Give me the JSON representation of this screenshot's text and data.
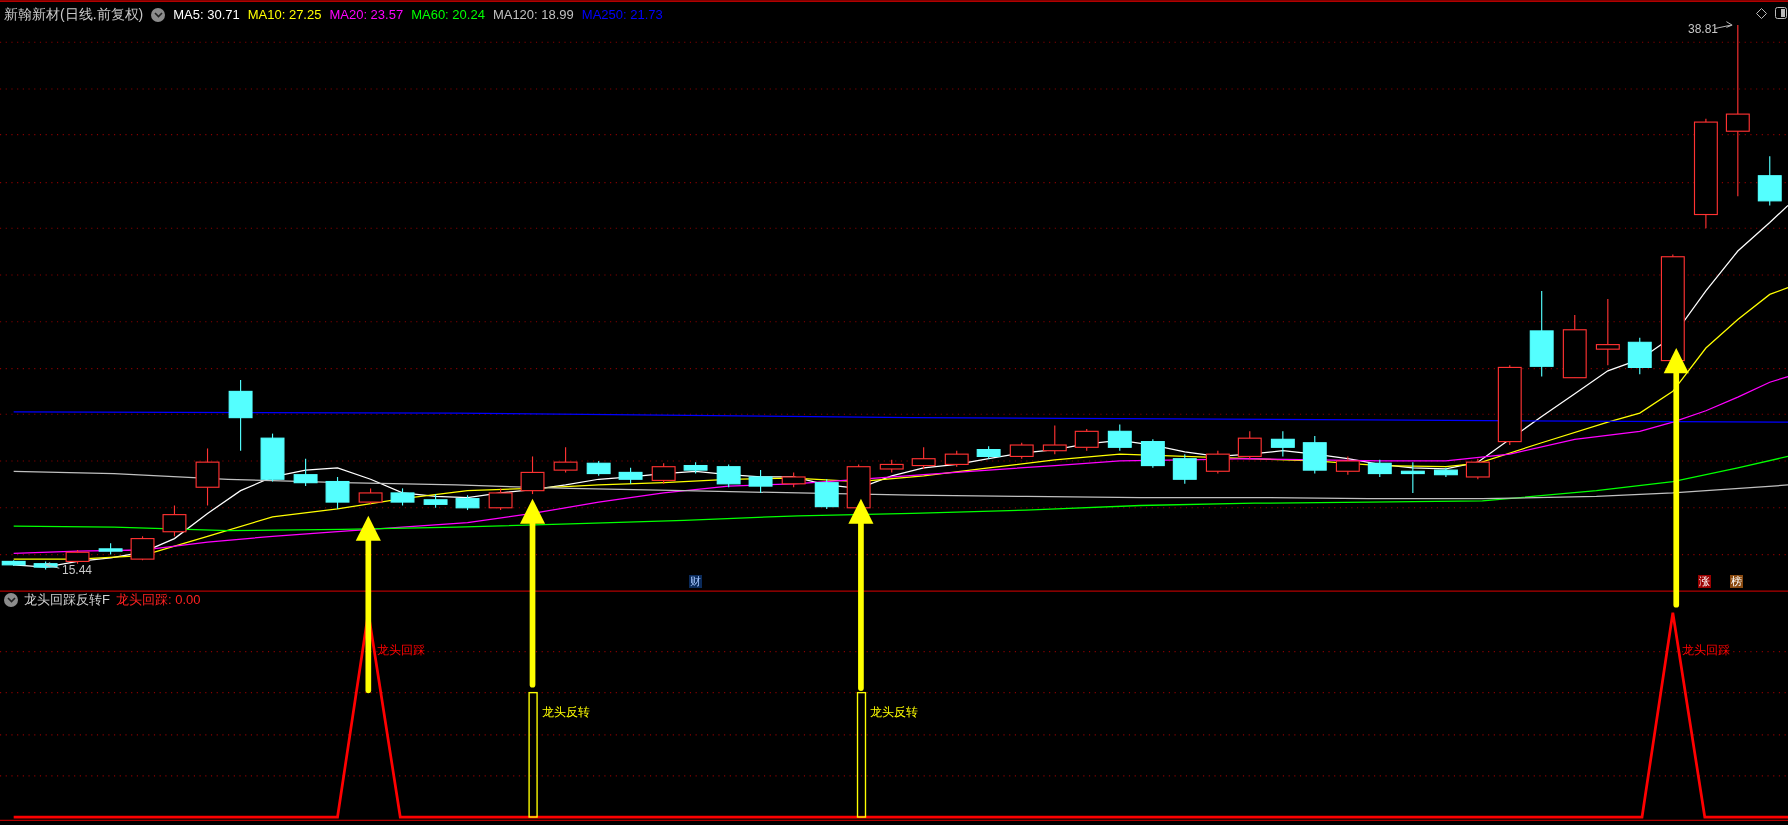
{
  "header": {
    "title": "新翰新材(日线.前复权)",
    "indicators": [
      {
        "label": "MA5: 30.71",
        "color": "#ffffff"
      },
      {
        "label": "MA10: 27.25",
        "color": "#ffff00"
      },
      {
        "label": "MA20: 23.57",
        "color": "#ff00ff"
      },
      {
        "label": "MA60: 20.24",
        "color": "#00ff00"
      },
      {
        "label": "MA120: 18.99",
        "color": "#c0c0c0"
      },
      {
        "label": "MA250: 21.73",
        "color": "#0000ff"
      }
    ]
  },
  "price_chart": {
    "high_label": "38.81",
    "low_label": "15.44",
    "markers": [
      {
        "text": "财",
        "kind": "finance"
      },
      {
        "text": "涨",
        "kind": "limit_up"
      },
      {
        "text": "榜",
        "kind": "ranking"
      }
    ]
  },
  "indicator_panel": {
    "name": "龙头回踩反转F",
    "reading": "龙头回踩: 0.00",
    "signals": [
      {
        "kind": "pullback",
        "label": "龙头回踩"
      },
      {
        "kind": "reversal",
        "label": "龙头反转"
      },
      {
        "kind": "reversal",
        "label": "龙头反转"
      },
      {
        "kind": "pullback",
        "label": "龙头回踩"
      }
    ]
  }
}
